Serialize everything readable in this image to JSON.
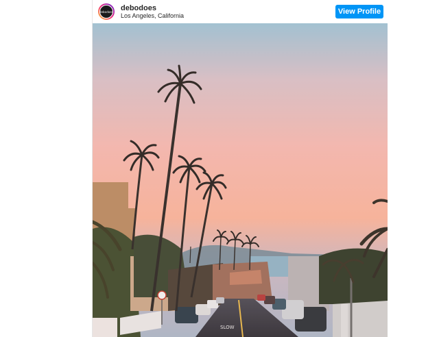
{
  "post": {
    "username": "debodoes",
    "location": "Los Angeles, California",
    "avatar_text": "debodoes",
    "view_profile_label": "View Profile"
  },
  "colors": {
    "button_blue": "#0095f6",
    "sky_top": "#9cc3d6",
    "sky_mid": "#f4b8b0",
    "sky_low": "#f7b49c"
  },
  "photo": {
    "road_marking": "SLOW"
  }
}
